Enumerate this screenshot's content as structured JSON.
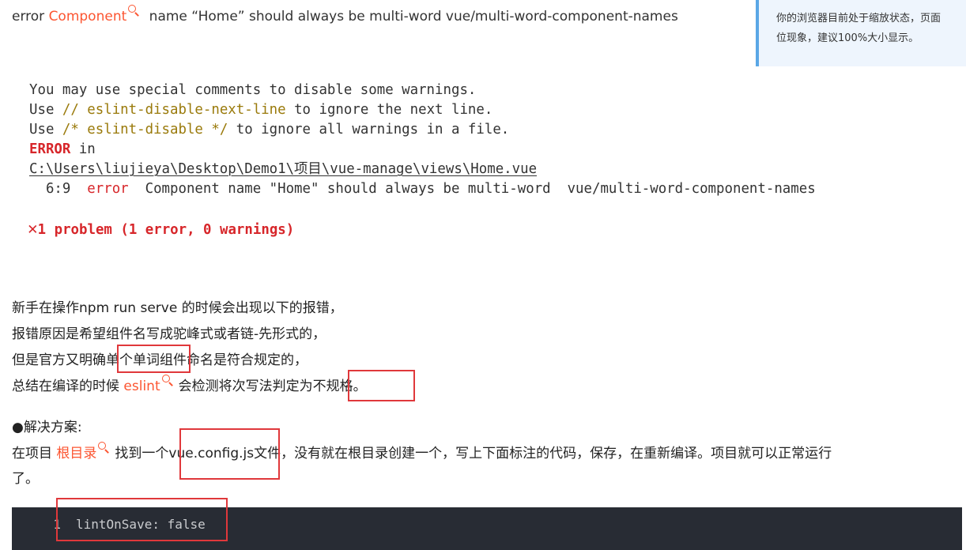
{
  "heading": {
    "prefix": "error ",
    "keyword": "Component",
    "suffix": " name “Home” should always be multi-word vue/multi-word-component-names"
  },
  "zoom_tip": {
    "line1": "你的浏览器目前处于缩放状态，页面",
    "line2": "位现象，建议100%大小显示。"
  },
  "terminal": {
    "line1": "You may use special comments to disable some warnings.",
    "line2_a": "Use ",
    "line2_b": "// eslint-disable-next-line",
    "line2_c": " to ignore the next line.",
    "line3_a": "Use ",
    "line3_b": "/* eslint-disable */",
    "line3_c": " to ignore all warnings in a file.",
    "line4_a": "ERROR",
    "line4_b": " in",
    "line5": "C:\\Users\\liujieya\\Desktop\\Demo1\\项目\\vue-manage\\views\\Home.vue",
    "line6_a": "  6:9  ",
    "line6_b": "error",
    "line6_c": "  Component name \"Home\" should always be multi-word  vue/multi-word-component-names",
    "problem_mark": "✕",
    "problem_text": "1 problem (1 error, 0 warnings)"
  },
  "article": {
    "p1": "新手在操作npm run serve 的时候会出现以下的报错，",
    "p2": "报错原因是希望组件名写成驼峰式或者链-先形式的，",
    "p3": "但是官方又明确单个单词组件命名是符合规定的，",
    "p4_a": "总结在编译的时候 ",
    "p4_link": "eslint",
    "p4_b": "会检测将次写法判定为不规格。",
    "solution_title": "●解决方案:",
    "p5_a": "在项目 ",
    "p5_link": "根目录",
    "p5_b": "找到一个vue.config.js文件，没有就在根目录创建一个，写上下面标注的代码，保存，在重新编译。项目就可以正常运行",
    "p5_c": "了。"
  },
  "code": {
    "line_number": "1",
    "line": "lintOnSave: false"
  }
}
